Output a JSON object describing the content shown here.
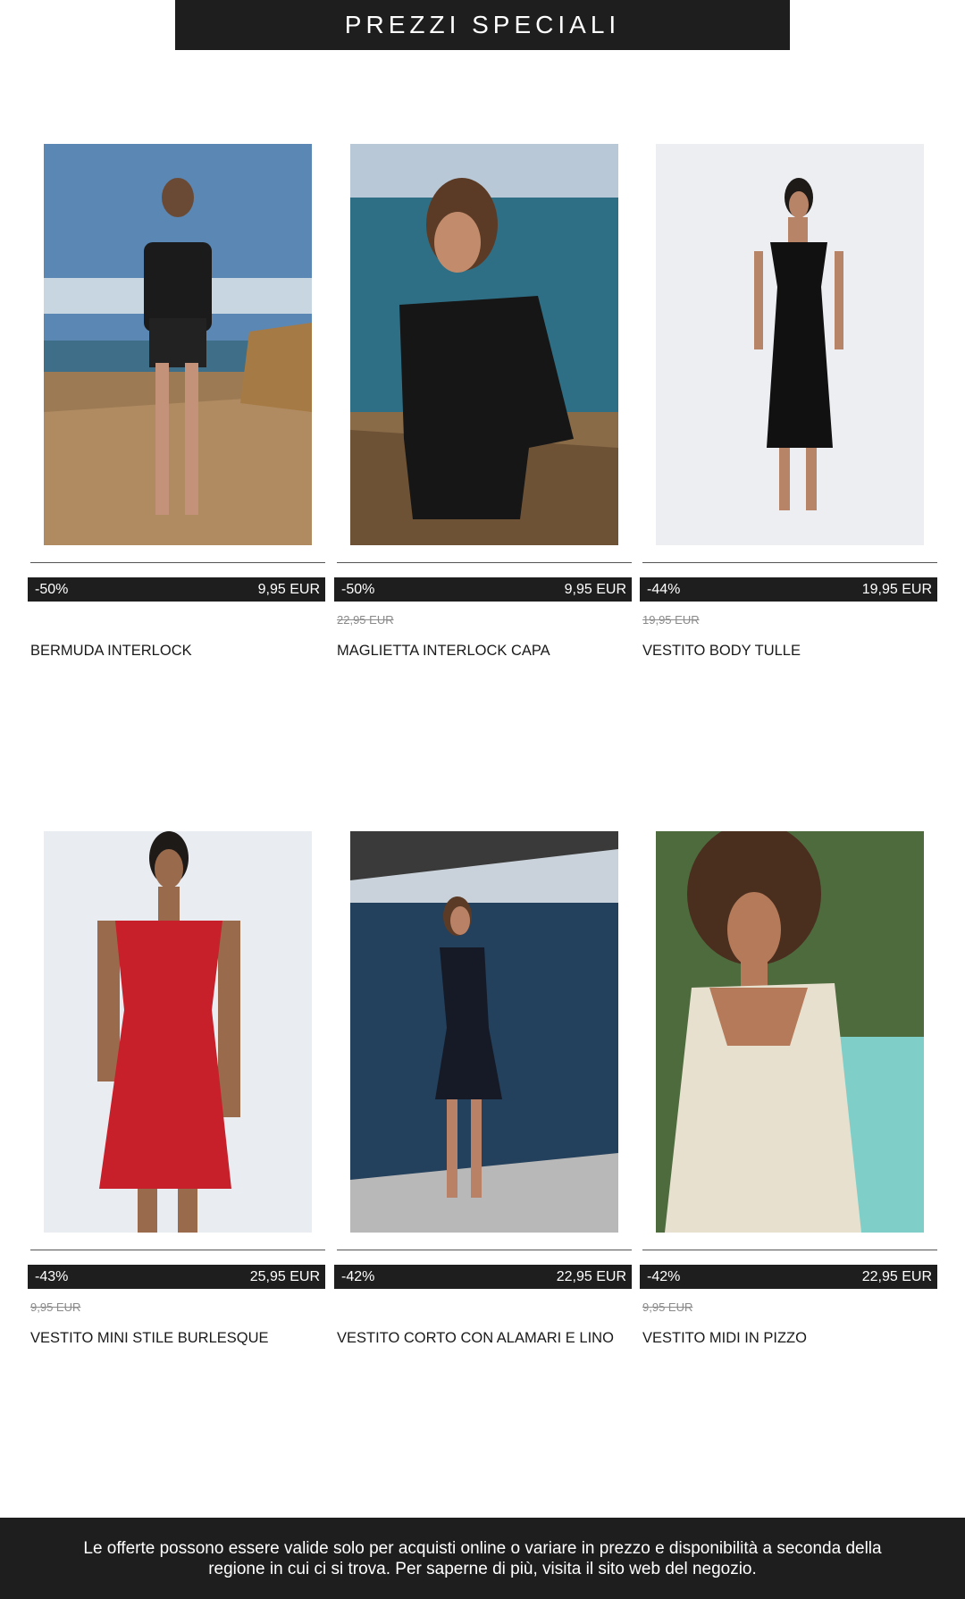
{
  "header": {
    "title": "PREZZI SPECIALI"
  },
  "products": [
    {
      "discount": "-50%",
      "price": "9,95 EUR",
      "old_price": "",
      "name": "BERMUDA INTERLOCK"
    },
    {
      "discount": "-50%",
      "price": "9,95 EUR",
      "old_price": "22,95 EUR",
      "name": "MAGLIETTA INTERLOCK CAPA"
    },
    {
      "discount": "-44%",
      "price": "19,95 EUR",
      "old_price": "19,95 EUR",
      "name": "VESTITO BODY TULLE"
    },
    {
      "discount": "-43%",
      "price": "25,95 EUR",
      "old_price": "9,95 EUR",
      "name": "VESTITO MINI STILE BURLESQUE"
    },
    {
      "discount": "-42%",
      "price": "22,95 EUR",
      "old_price": "",
      "name": "VESTITO CORTO CON ALAMARI E LINO"
    },
    {
      "discount": "-42%",
      "price": "22,95 EUR",
      "old_price": "9,95 EUR",
      "name": "VESTITO MIDI IN PIZZO"
    }
  ],
  "footer": {
    "line1": "Le offerte possono essere valide solo per acquisti online o variare in prezzo e disponibilità a seconda della",
    "line2": "regione in cui ci si trova. Per saperne di più, visita il sito web del negozio."
  }
}
